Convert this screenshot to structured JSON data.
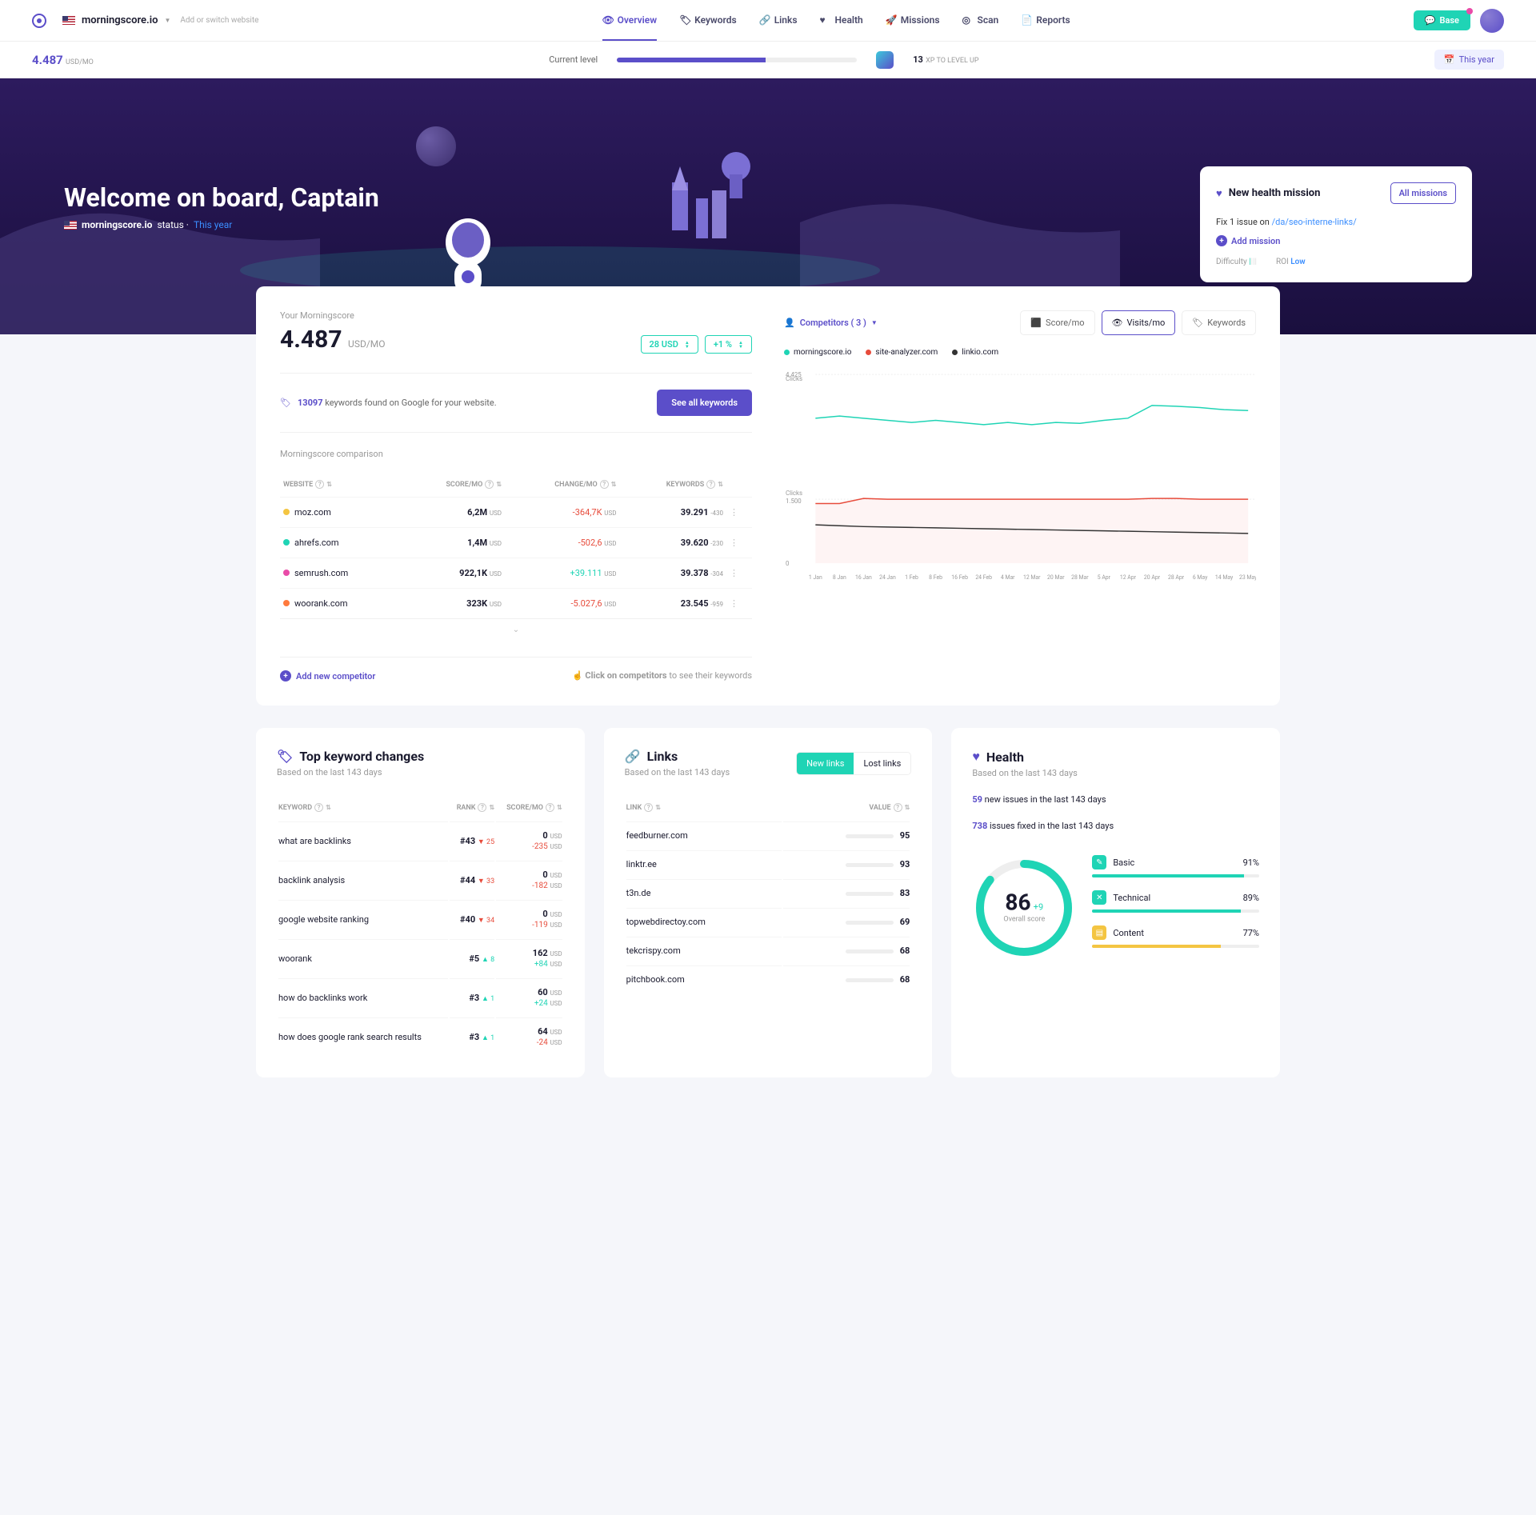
{
  "topbar": {
    "domain": "morningscore.io",
    "add_switch": "Add or switch website",
    "nav": [
      {
        "label": "Overview",
        "icon": "eye",
        "active": true
      },
      {
        "label": "Keywords",
        "icon": "tag"
      },
      {
        "label": "Links",
        "icon": "link"
      },
      {
        "label": "Health",
        "icon": "heart"
      },
      {
        "label": "Missions",
        "icon": "rocket"
      },
      {
        "label": "Scan",
        "icon": "radar"
      },
      {
        "label": "Reports",
        "icon": "file"
      }
    ],
    "base_btn": "Base"
  },
  "subbar": {
    "score": "4.487",
    "score_unit": "USD/MO",
    "level_label": "Current level",
    "xp_value": "13",
    "xp_label": "XP TO LEVEL UP",
    "year_btn": "This year"
  },
  "hero": {
    "title": "Welcome on board, Captain",
    "domain": "morningscore.io",
    "status_suffix": " status · ",
    "period": "This year",
    "mission_title": "New health mission",
    "all_missions": "All missions",
    "mission_text_pre": "Fix 1 issue on ",
    "mission_link": "/da/seo-interne-links/",
    "add_mission": "Add mission",
    "difficulty_label": "Difficulty",
    "roi_label": "ROI",
    "roi_value": "Low"
  },
  "morningscore": {
    "label": "Your Morningscore",
    "value": "4.487",
    "unit": "USD/MO",
    "chip1": "28 USD",
    "chip2": "+1 %",
    "kw_count": "13097",
    "kw_text": " keywords found on Google for your website.",
    "see_all": "See all keywords",
    "comparison_title": "Morningscore comparison",
    "headers": {
      "website": "WEBSITE",
      "score": "SCORE/MO",
      "change": "CHANGE/MO",
      "keywords": "KEYWORDS"
    },
    "rows": [
      {
        "site": "moz.com",
        "color": "#f4c542",
        "score": "6,2M",
        "change": "-364,7K",
        "neg": true,
        "kw": "39.291",
        "delta": "-430"
      },
      {
        "site": "ahrefs.com",
        "color": "#1fd4b5",
        "score": "1,4M",
        "change": "-502,6",
        "neg": true,
        "kw": "39.620",
        "delta": "-230"
      },
      {
        "site": "semrush.com",
        "color": "#e94ba8",
        "score": "922,1K",
        "change": "+39.111",
        "neg": false,
        "kw": "39.378",
        "delta": "-304"
      },
      {
        "site": "woorank.com",
        "color": "#ff7a3d",
        "score": "323K",
        "change": "-5.027,6",
        "neg": true,
        "kw": "23.545",
        "delta": "-959"
      }
    ],
    "add_competitor": "Add new competitor",
    "click_hint_pre": "Click on competitors",
    "click_hint_post": " to see their keywords",
    "usd": "USD"
  },
  "chart": {
    "competitors_label": "Competitors ( 3 )",
    "tabs": [
      "Score/mo",
      "Visits/mo",
      "Keywords"
    ],
    "active_tab": 1,
    "legend": [
      {
        "label": "morningscore.io",
        "color": "#1fd4b5"
      },
      {
        "label": "site-analyzer.com",
        "color": "#e74c3c"
      },
      {
        "label": "linkio.com",
        "color": "#333"
      }
    ],
    "y_label": "Clicks",
    "y_ticks": [
      "4.425",
      "1.500",
      "0"
    ],
    "x_ticks": [
      "1 Jan",
      "8 Jan",
      "16 Jan",
      "24 Jan",
      "1 Feb",
      "8 Feb",
      "16 Feb",
      "24 Feb",
      "4 Mar",
      "12 Mar",
      "20 Mar",
      "28 Mar",
      "5 Apr",
      "12 Apr",
      "20 Apr",
      "28 Apr",
      "6 May",
      "14 May",
      "23 May"
    ]
  },
  "chart_data": {
    "type": "line",
    "xlabel": "",
    "ylabel": "Clicks",
    "ylim": [
      0,
      4425
    ],
    "categories": [
      "1 Jan",
      "8 Jan",
      "16 Jan",
      "24 Jan",
      "1 Feb",
      "8 Feb",
      "16 Feb",
      "24 Feb",
      "4 Mar",
      "12 Mar",
      "20 Mar",
      "28 Mar",
      "5 Apr",
      "12 Apr",
      "20 Apr",
      "28 Apr",
      "6 May",
      "14 May",
      "23 May"
    ],
    "series": [
      {
        "name": "morningscore.io",
        "color": "#1fd4b5",
        "values": [
          3400,
          3450,
          3400,
          3350,
          3300,
          3350,
          3300,
          3250,
          3300,
          3250,
          3300,
          3280,
          3350,
          3400,
          3700,
          3680,
          3650,
          3600,
          3580
        ]
      },
      {
        "name": "site-analyzer.com",
        "color": "#e74c3c",
        "values": [
          1400,
          1400,
          1520,
          1500,
          1500,
          1500,
          1500,
          1500,
          1500,
          1500,
          1500,
          1500,
          1500,
          1500,
          1520,
          1520,
          1500,
          1500,
          1500
        ]
      },
      {
        "name": "linkio.com",
        "color": "#333",
        "values": [
          900,
          880,
          860,
          850,
          840,
          830,
          820,
          810,
          800,
          790,
          780,
          770,
          760,
          750,
          740,
          730,
          720,
          710,
          700
        ]
      }
    ]
  },
  "top_keywords": {
    "title": "Top keyword changes",
    "sub": "Based on the last 143 days",
    "headers": {
      "kw": "KEYWORD",
      "rank": "RANK",
      "score": "SCORE/MO"
    },
    "rows": [
      {
        "kw": "what are backlinks",
        "rank": "#43",
        "rc": "25",
        "dir": "down",
        "score": "0",
        "scoreUnit": "USD",
        "delta": "-235",
        "deltaUnit": "USD"
      },
      {
        "kw": "backlink analysis",
        "rank": "#44",
        "rc": "33",
        "dir": "down",
        "score": "0",
        "scoreUnit": "USD",
        "delta": "-182",
        "deltaUnit": "USD"
      },
      {
        "kw": "google website ranking",
        "rank": "#40",
        "rc": "34",
        "dir": "down",
        "score": "0",
        "scoreUnit": "USD",
        "delta": "-119",
        "deltaUnit": "USD"
      },
      {
        "kw": "woorank",
        "rank": "#5",
        "rc": "8",
        "dir": "up",
        "score": "162",
        "scoreUnit": "USD",
        "delta": "+84",
        "deltaUnit": "USD"
      },
      {
        "kw": "how do backlinks work",
        "rank": "#3",
        "rc": "1",
        "dir": "up",
        "score": "60",
        "scoreUnit": "USD",
        "delta": "+24",
        "deltaUnit": "USD"
      },
      {
        "kw": "how does google rank search results",
        "rank": "#3",
        "rc": "1",
        "dir": "up",
        "score": "64",
        "scoreUnit": "USD",
        "delta": "-24",
        "deltaUnit": "USD"
      }
    ]
  },
  "links": {
    "title": "Links",
    "sub": "Based on the last 143 days",
    "new": "New links",
    "lost": "Lost links",
    "headers": {
      "link": "LINK",
      "value": "VALUE"
    },
    "rows": [
      {
        "link": "feedburner.com",
        "value": 95
      },
      {
        "link": "linktr.ee",
        "value": 93
      },
      {
        "link": "t3n.de",
        "value": 83
      },
      {
        "link": "topwebdirectoy.com",
        "value": 69
      },
      {
        "link": "tekcrispy.com",
        "value": 68
      },
      {
        "link": "pitchbook.com",
        "value": 68
      }
    ]
  },
  "health": {
    "title": "Health",
    "sub": "Based on the last 143 days",
    "new_issues_n": "59",
    "new_issues_t": " new issues in the last 143 days",
    "fixed_n": "738",
    "fixed_t": " issues fixed in the last 143 days",
    "score": "86",
    "delta": "+9",
    "overall": "Overall score",
    "cats": [
      {
        "name": "Basic",
        "pct": 91,
        "color": "#1fd4b5"
      },
      {
        "name": "Technical",
        "pct": 89,
        "color": "#1fd4b5"
      },
      {
        "name": "Content",
        "pct": 77,
        "color": "#f4c542"
      }
    ]
  }
}
